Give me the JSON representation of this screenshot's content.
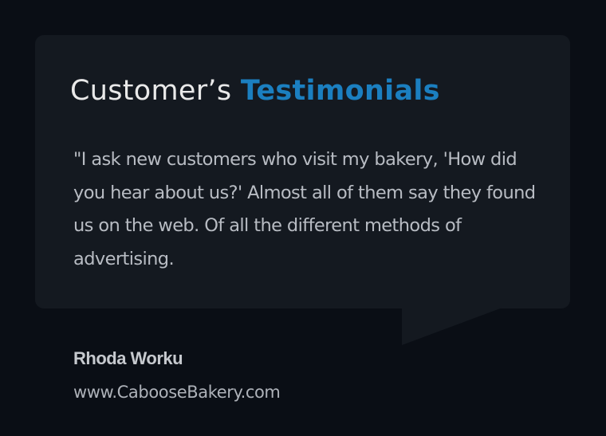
{
  "testimonial": {
    "heading_plain": "Customer’s",
    "heading_accent": "Testimonials",
    "quote": "\"I ask new customers who visit my bakery, 'How did you hear about us?' Almost all of them say they found us on the web. Of all the different methods of advertising.",
    "author_name": "Rhoda Worku",
    "author_website": "www.CabooseBakery.com"
  },
  "colors": {
    "page_background": "#0a0e15",
    "card_background": "#141920",
    "heading_text": "#e9e9e9",
    "accent_blue": "#1b7fc0",
    "body_text": "#b8bcc3"
  }
}
